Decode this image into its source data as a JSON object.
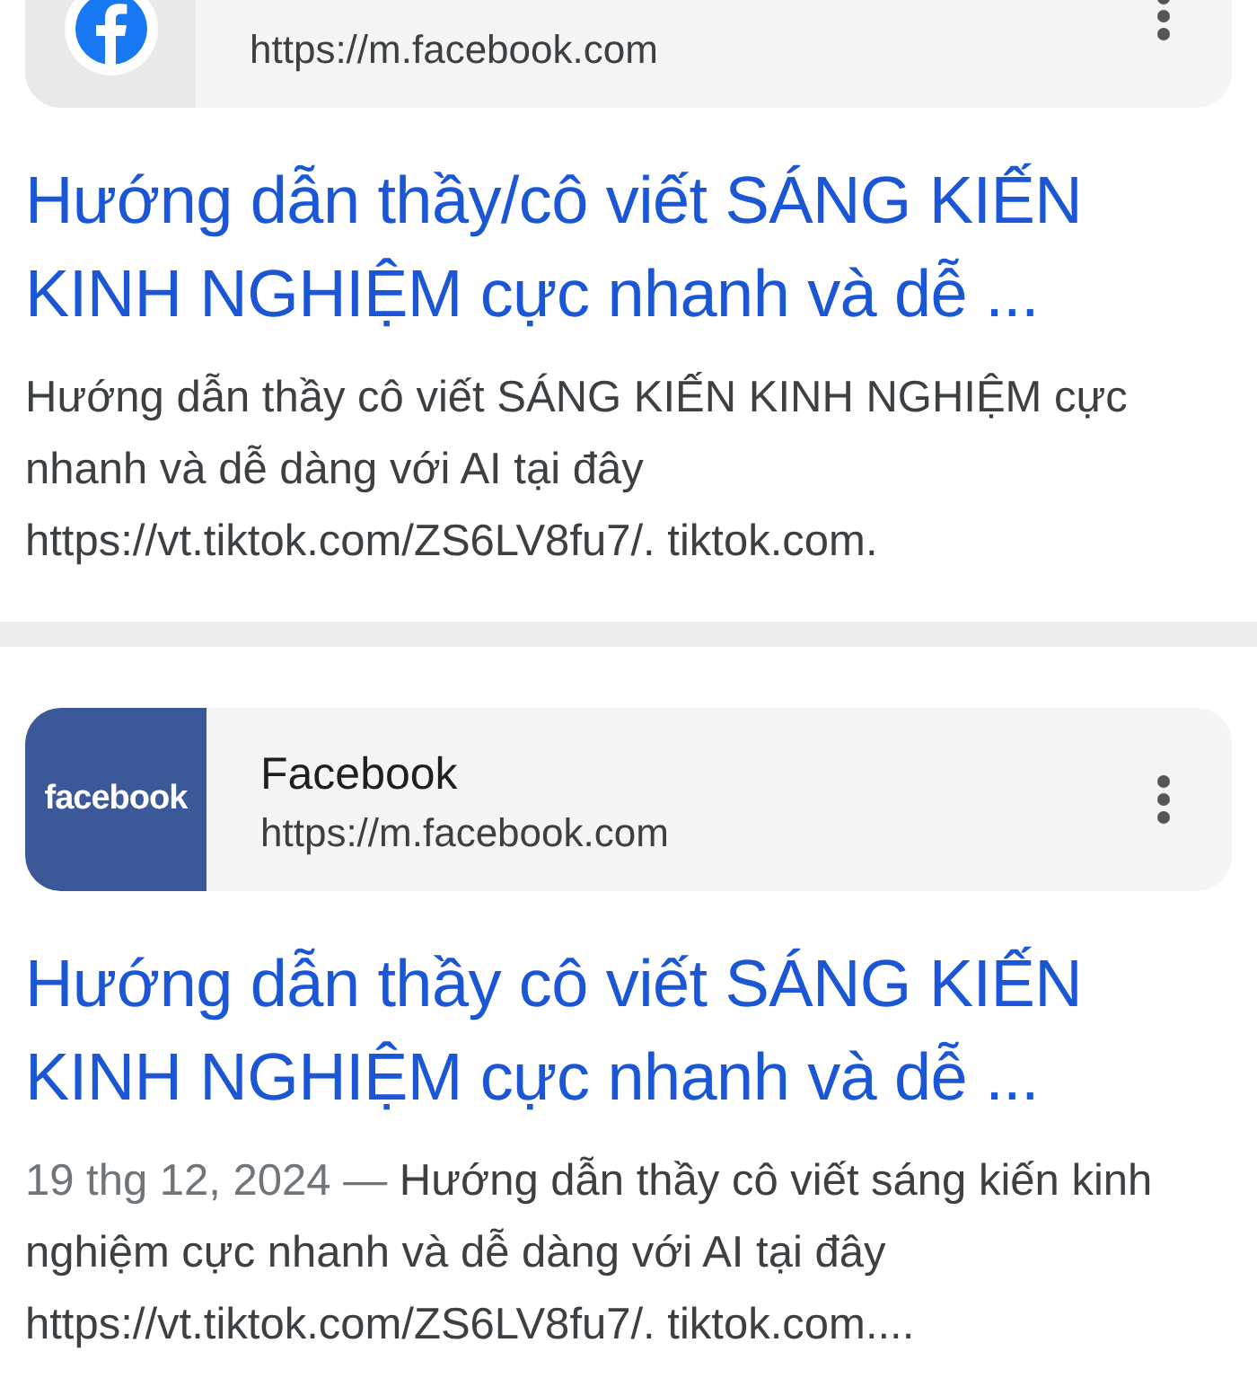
{
  "results": [
    {
      "source": {
        "kind": "round",
        "url": "https://m.facebook.com"
      },
      "title": "Hướng dẫn thầy/cô viết SÁNG KIẾN KINH NGHIỆM cực nhanh và dễ ...",
      "snippet": "Hướng dẫn thầy cô viết SÁNG KIẾN KINH NGHIỆM cực nhanh và dễ dàng với AI tại đây https://vt.tiktok.com/ZS6LV8fu7/. tiktok.com."
    },
    {
      "source": {
        "kind": "wordmark",
        "logo_text": "facebook",
        "name": "Facebook",
        "url": "https://m.facebook.com"
      },
      "title": "Hướng dẫn thầy cô viết SÁNG KIẾN KINH NGHIỆM cực nhanh và dễ ...",
      "date": "19 thg 12, 2024 —",
      "snippet": "Hướng dẫn thầy cô viết sáng kiến kinh nghiệm cực nhanh và dễ dàng với AI tại đây https://vt.tiktok.com/ZS6LV8fu7/. tiktok.com...."
    }
  ]
}
